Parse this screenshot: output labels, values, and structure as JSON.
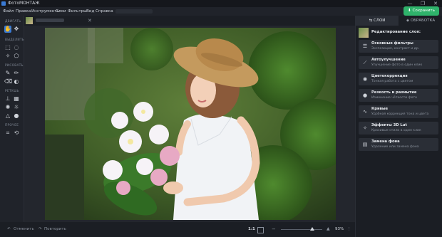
{
  "app": {
    "title": "ФотоМОНТАЖ"
  },
  "window": {
    "minimize": "—",
    "maximize": "❐",
    "close": "✕"
  },
  "menu": [
    "Файл",
    "Правка",
    "Инструменты",
    "Слои",
    "Фильтры",
    "Вид",
    "Справка"
  ],
  "save_button": "Сохранить",
  "tools": {
    "sections": {
      "move": "ДВИГАТЬ",
      "select": "ВЫДЕЛИТЬ",
      "draw": "РИСОВАТЬ",
      "retouch": "РЕТУШЬ",
      "other": "ПРОЧЕЕ"
    },
    "icons": [
      "hand-icon",
      "move-icon",
      "rect-select-icon",
      "lasso-icon",
      "magic-select-icon",
      "poly-select-icon",
      "brush-icon",
      "pencil-icon",
      "eraser-icon",
      "fill-icon",
      "stamp-icon",
      "patch-icon",
      "dodge-icon",
      "burn-icon",
      "blur-icon",
      "drop-icon",
      "crop-icon",
      "transform-icon"
    ]
  },
  "tabs": {
    "close": "✕"
  },
  "bottom": {
    "undo": "Отменить",
    "redo": "Повторить",
    "ratio": "1:1",
    "zoom": "93%",
    "zoom_level": 0.75
  },
  "right_panel": {
    "tab_layers": "СЛОИ",
    "tab_processing": "ОБРАБОТКА",
    "header": "Редактирование слоя:",
    "items": [
      {
        "title": "Основные фильтры",
        "desc": "Экспозиция, контраст и др.",
        "icon": "sliders-icon"
      },
      {
        "title": "Автоулучшение",
        "desc": "Улучшение фото в один клик",
        "icon": "magic-wand-icon"
      },
      {
        "title": "Цветокоррекция",
        "desc": "Тонкая работа с цветом",
        "icon": "palette-icon"
      },
      {
        "title": "Резкость и размытие",
        "desc": "Изменение чёткости фото",
        "icon": "drop-icon"
      },
      {
        "title": "Кривые",
        "desc": "Удобная коррекция тона и цвета",
        "icon": "curves-icon"
      },
      {
        "title": "Эффекты 3D Lut",
        "desc": "Красивые стили в один клик",
        "icon": "sparkle-icon"
      },
      {
        "title": "Замена фона",
        "desc": "Удаление или замена фона",
        "icon": "layers-icon"
      }
    ]
  }
}
